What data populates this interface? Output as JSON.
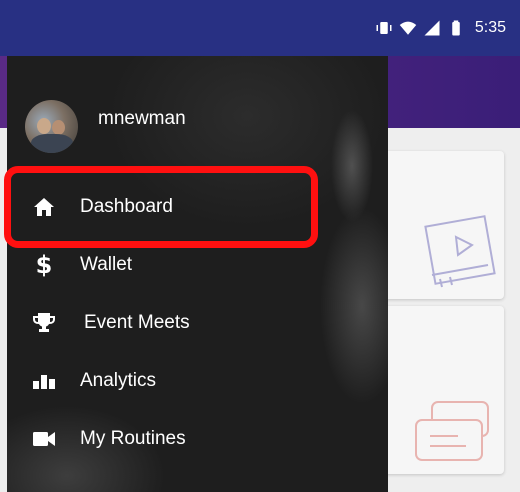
{
  "status_bar": {
    "time": "5:35",
    "icons": [
      "vibrate-icon",
      "wifi-icon",
      "signal-icon",
      "battery-icon"
    ]
  },
  "drawer": {
    "username": "mnewman",
    "items": [
      {
        "label": "Dashboard",
        "icon": "home-icon",
        "selected": true
      },
      {
        "label": "Wallet",
        "icon": "dollar-icon"
      },
      {
        "label": "Event Meets",
        "icon": "trophy-icon"
      },
      {
        "label": "Analytics",
        "icon": "bar-chart-icon"
      },
      {
        "label": "My Routines",
        "icon": "video-camera-icon"
      }
    ]
  },
  "colors": {
    "status_bar": "#283083",
    "toolbar": "#4a2384",
    "highlight": "#ff1010",
    "drawer_bg": "#1e1e1e"
  }
}
